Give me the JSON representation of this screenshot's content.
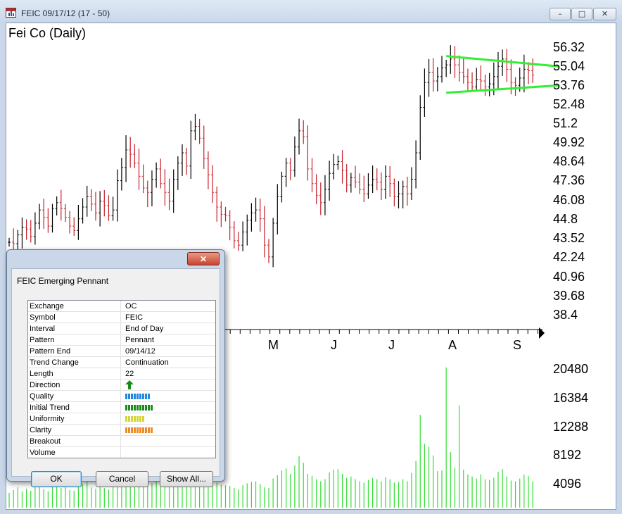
{
  "window": {
    "title": "FEIC 09/17/12 (17 - 50)",
    "buttons": {
      "minimize": "–",
      "maximize": "□",
      "close": "✕"
    }
  },
  "chart": {
    "title": "Fei Co (Daily)",
    "price_labels": [
      "56.32",
      "55.04",
      "53.76",
      "52.48",
      "51.2",
      "49.92",
      "48.64",
      "47.36",
      "46.08",
      "44.8",
      "43.52",
      "42.24",
      "40.96",
      "39.68",
      "38.4"
    ],
    "volume_labels": [
      "20480",
      "16384",
      "12288",
      "8192",
      "4096"
    ],
    "months": [
      "M",
      "J",
      "J",
      "A",
      "S"
    ],
    "colors": {
      "up_bar": "#000000",
      "down_bar": "#c8202a",
      "volume": "#33dd33",
      "pennant": "#33ee33"
    }
  },
  "chart_data": {
    "type": "ohlc",
    "interval": "daily",
    "ylim": [
      38.4,
      56.32
    ],
    "price_ticks": [
      56.32,
      55.04,
      53.76,
      52.48,
      51.2,
      49.92,
      48.64,
      47.36,
      46.08,
      44.8,
      43.52,
      42.24,
      40.96,
      39.68,
      38.4
    ],
    "volume_ticks": [
      20480,
      16384,
      12288,
      8192,
      4096
    ],
    "x_months": [
      "M",
      "J",
      "J",
      "A",
      "S"
    ],
    "close": [
      43.3,
      43.2,
      43.8,
      44.3,
      44.2,
      43.7,
      44.6,
      45.5,
      45.0,
      44.4,
      45.6,
      46.0,
      45.6,
      45.0,
      44.4,
      44.1,
      44.9,
      45.7,
      46.4,
      45.9,
      45.3,
      46.1,
      45.8,
      45.1,
      45.5,
      47.5,
      48.4,
      49.6,
      49.3,
      48.7,
      47.8,
      47.0,
      46.7,
      47.6,
      48.3,
      47.3,
      46.7,
      46.1,
      47.6,
      48.7,
      49.4,
      48.5,
      50.9,
      51.2,
      50.4,
      49.0,
      47.9,
      46.7,
      45.7,
      45.2,
      45.1,
      44.3,
      43.4,
      43.1,
      44.0,
      44.8,
      45.3,
      45.5,
      44.9,
      43.1,
      42.3,
      44.6,
      46.4,
      47.8,
      48.7,
      48.2,
      49.8,
      50.9,
      50.5,
      48.3,
      47.3,
      46.5,
      46.0,
      46.9,
      48.0,
      48.6,
      48.8,
      48.2,
      47.2,
      47.7,
      47.4,
      46.9,
      46.6,
      47.2,
      47.6,
      47.4,
      46.9,
      47.8,
      47.3,
      46.4,
      46.6,
      47.1,
      46.6,
      47.6,
      49.4,
      52.5,
      54.2,
      54.9,
      54.3,
      54.6,
      55.2,
      55.4,
      55.8,
      55.4,
      54.9,
      54.6,
      54.2,
      53.9,
      54.4,
      54.3,
      53.9,
      54.1,
      54.6,
      55.3,
      55.8,
      55.1,
      54.2,
      54.0,
      54.5,
      55.1,
      55.0,
      54.7
    ],
    "pennant": {
      "upper": [
        [
          101,
          56.0
        ],
        [
          127,
          55.3
        ]
      ],
      "lower": [
        [
          101,
          53.5
        ],
        [
          127,
          54.0
        ]
      ]
    },
    "volume": [
      2200,
      2600,
      3000,
      2400,
      2800,
      2500,
      3100,
      3300,
      2700,
      2400,
      3600,
      3800,
      2900,
      3000,
      2600,
      2500,
      3200,
      3500,
      3800,
      3000,
      2800,
      3300,
      2900,
      2700,
      3100,
      4200,
      4400,
      4800,
      4500,
      3900,
      3700,
      3500,
      3300,
      3600,
      4300,
      3800,
      3500,
      3100,
      3900,
      4500,
      5100,
      4400,
      10600,
      6600,
      5300,
      4900,
      4200,
      3900,
      3700,
      3400,
      3300,
      3200,
      2900,
      2700,
      3300,
      3600,
      3800,
      3900,
      3500,
      3000,
      2900,
      4300,
      4800,
      5500,
      5800,
      5000,
      6200,
      7600,
      6600,
      5000,
      4700,
      4200,
      3900,
      4200,
      5200,
      5600,
      5700,
      5000,
      4400,
      4600,
      4200,
      3900,
      3700,
      4100,
      4400,
      4200,
      3900,
      4500,
      4200,
      3700,
      3800,
      4200,
      3900,
      5100,
      6900,
      13700,
      9400,
      9000,
      7700,
      5400,
      5500,
      20700,
      8200,
      5900,
      15100,
      5600,
      4900,
      4600,
      4300,
      4900,
      4200,
      4100,
      4400,
      5300,
      5700,
      4600,
      4000,
      3900,
      4300,
      4900,
      4700,
      3900
    ]
  },
  "dialog": {
    "title": "FEIC  Emerging Pennant",
    "close": "✕",
    "rows": [
      {
        "key": "Exchange",
        "value": "OC"
      },
      {
        "key": "Symbol",
        "value": "FEIC"
      },
      {
        "key": "Interval",
        "value": "End of Day"
      },
      {
        "key": "Pattern",
        "value": "Pennant"
      },
      {
        "key": "Pattern End",
        "value": "09/14/12"
      },
      {
        "key": "Trend Change",
        "value": "Continuation"
      },
      {
        "key": "Length",
        "value": "22"
      },
      {
        "key": "Direction",
        "value": ""
      },
      {
        "key": "Quality",
        "value": ""
      },
      {
        "key": "Initial Trend",
        "value": ""
      },
      {
        "key": "Uniformity",
        "value": ""
      },
      {
        "key": "Clarity",
        "value": ""
      },
      {
        "key": "Breakout",
        "value": ""
      },
      {
        "key": "Volume",
        "value": ""
      }
    ],
    "ratings": {
      "quality": {
        "level": 0.9,
        "color": "#1e88e5"
      },
      "initial_trend": {
        "level": 1.0,
        "color": "#1b8a1b"
      },
      "uniformity": {
        "level": 0.7,
        "color": "#d4d436"
      },
      "clarity": {
        "level": 1.0,
        "color": "#f08a24"
      }
    },
    "direction": "up-arrow-icon",
    "buttons": {
      "ok": "OK",
      "cancel": "Cancel",
      "show_all": "Show All..."
    }
  }
}
